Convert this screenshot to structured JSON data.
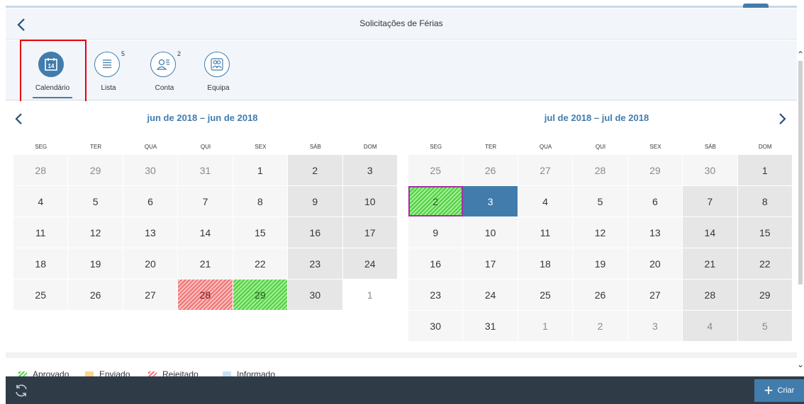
{
  "app": {
    "title": "Solicitações de Férias"
  },
  "tabs": [
    {
      "key": "calendar",
      "label": "Calendário",
      "badge": "",
      "icon": "calendar-icon",
      "active": true
    },
    {
      "key": "list",
      "label": "Lista",
      "badge": "5",
      "icon": "list-icon",
      "active": false
    },
    {
      "key": "account",
      "label": "Conta",
      "badge": "2",
      "icon": "person-list-icon",
      "active": false
    },
    {
      "key": "team",
      "label": "Equipa",
      "badge": "",
      "icon": "team-icon",
      "active": false
    }
  ],
  "calendar_icon_day": "14",
  "weekdays": [
    "SEG",
    "TER",
    "QUA",
    "QUI",
    "SEX",
    "SÁB",
    "DOM"
  ],
  "months": [
    {
      "title": "jun de 2018 – jun de 2018",
      "weeks": [
        [
          {
            "d": "28",
            "s": "other"
          },
          {
            "d": "29",
            "s": "other"
          },
          {
            "d": "30",
            "s": "other"
          },
          {
            "d": "31",
            "s": "other"
          },
          {
            "d": "1",
            "s": ""
          },
          {
            "d": "2",
            "s": "weekend"
          },
          {
            "d": "3",
            "s": "weekend"
          }
        ],
        [
          {
            "d": "4",
            "s": ""
          },
          {
            "d": "5",
            "s": ""
          },
          {
            "d": "6",
            "s": ""
          },
          {
            "d": "7",
            "s": ""
          },
          {
            "d": "8",
            "s": ""
          },
          {
            "d": "9",
            "s": "weekend"
          },
          {
            "d": "10",
            "s": "weekend"
          }
        ],
        [
          {
            "d": "11",
            "s": ""
          },
          {
            "d": "12",
            "s": ""
          },
          {
            "d": "13",
            "s": ""
          },
          {
            "d": "14",
            "s": ""
          },
          {
            "d": "15",
            "s": ""
          },
          {
            "d": "16",
            "s": "weekend"
          },
          {
            "d": "17",
            "s": "weekend"
          }
        ],
        [
          {
            "d": "18",
            "s": ""
          },
          {
            "d": "19",
            "s": ""
          },
          {
            "d": "20",
            "s": ""
          },
          {
            "d": "21",
            "s": ""
          },
          {
            "d": "22",
            "s": ""
          },
          {
            "d": "23",
            "s": "weekend"
          },
          {
            "d": "24",
            "s": "weekend"
          }
        ],
        [
          {
            "d": "25",
            "s": ""
          },
          {
            "d": "26",
            "s": ""
          },
          {
            "d": "27",
            "s": ""
          },
          {
            "d": "28",
            "s": "rejected"
          },
          {
            "d": "29",
            "s": "approved"
          },
          {
            "d": "30",
            "s": "weekend"
          },
          {
            "d": "1",
            "s": "other-white"
          }
        ]
      ]
    },
    {
      "title": "jul de 2018 – jul de 2018",
      "weeks": [
        [
          {
            "d": "25",
            "s": "other"
          },
          {
            "d": "26",
            "s": "other"
          },
          {
            "d": "27",
            "s": "other"
          },
          {
            "d": "28",
            "s": "other"
          },
          {
            "d": "29",
            "s": "other"
          },
          {
            "d": "30",
            "s": "other"
          },
          {
            "d": "1",
            "s": "weekend"
          }
        ],
        [
          {
            "d": "2",
            "s": "approved selected"
          },
          {
            "d": "3",
            "s": "today"
          },
          {
            "d": "4",
            "s": ""
          },
          {
            "d": "5",
            "s": ""
          },
          {
            "d": "6",
            "s": ""
          },
          {
            "d": "7",
            "s": "weekend"
          },
          {
            "d": "8",
            "s": "weekend"
          }
        ],
        [
          {
            "d": "9",
            "s": ""
          },
          {
            "d": "10",
            "s": ""
          },
          {
            "d": "11",
            "s": ""
          },
          {
            "d": "12",
            "s": ""
          },
          {
            "d": "13",
            "s": ""
          },
          {
            "d": "14",
            "s": "weekend"
          },
          {
            "d": "15",
            "s": "weekend"
          }
        ],
        [
          {
            "d": "16",
            "s": ""
          },
          {
            "d": "17",
            "s": ""
          },
          {
            "d": "18",
            "s": ""
          },
          {
            "d": "19",
            "s": ""
          },
          {
            "d": "20",
            "s": ""
          },
          {
            "d": "21",
            "s": "weekend"
          },
          {
            "d": "22",
            "s": "weekend"
          }
        ],
        [
          {
            "d": "23",
            "s": ""
          },
          {
            "d": "24",
            "s": ""
          },
          {
            "d": "25",
            "s": ""
          },
          {
            "d": "26",
            "s": ""
          },
          {
            "d": "27",
            "s": ""
          },
          {
            "d": "28",
            "s": "weekend"
          },
          {
            "d": "29",
            "s": "weekend"
          }
        ],
        [
          {
            "d": "30",
            "s": ""
          },
          {
            "d": "31",
            "s": ""
          },
          {
            "d": "1",
            "s": "other"
          },
          {
            "d": "2",
            "s": "other"
          },
          {
            "d": "3",
            "s": "other"
          },
          {
            "d": "4",
            "s": "other weekend"
          },
          {
            "d": "5",
            "s": "other weekend"
          }
        ]
      ]
    }
  ],
  "legend": [
    {
      "label": "Aprovado",
      "color": "#4cd23c",
      "pattern": "hatched"
    },
    {
      "label": "Enviado",
      "color": "#f9d68a",
      "pattern": "solid"
    },
    {
      "label": "Rejeitado",
      "color": "#f07474",
      "pattern": "hatched"
    },
    {
      "label": "Informado",
      "color": "#c6e2f6",
      "pattern": "solid"
    }
  ],
  "footer": {
    "create_label": "Criar"
  },
  "colors": {
    "accent": "#427cac",
    "footer": "#2f3c48",
    "selection": "#e8000d"
  }
}
